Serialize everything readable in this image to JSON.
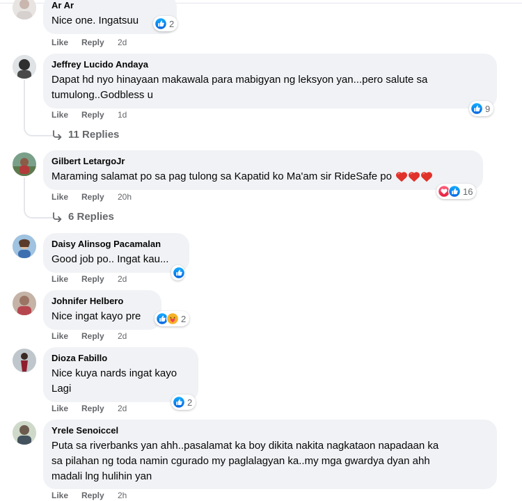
{
  "comments": [
    {
      "author": "Ar Ar",
      "text": "Nice one. Ingatsuu",
      "actions": {
        "like": "Like",
        "reply": "Reply",
        "time": "2d"
      },
      "reactions": {
        "icons": [
          "like"
        ],
        "count": "2"
      }
    },
    {
      "author": "Jeffrey Lucido Andaya",
      "text_lines": [
        "Dapat hd nyo hinayaan makawala para mabigyan ng leksyon yan...pero salute sa",
        "tumulong..Godbless u"
      ],
      "actions": {
        "like": "Like",
        "reply": "Reply",
        "time": "1d"
      },
      "reactions": {
        "icons": [
          "like"
        ],
        "count": "9"
      },
      "replies_label": "11 Replies"
    },
    {
      "author": "Gilbert LetargoJr",
      "text": "Maraming salamat po sa pag tulong sa Kapatid ko Ma'am sir RideSafe po",
      "emoji": [
        "heart",
        "heart",
        "heart"
      ],
      "actions": {
        "like": "Like",
        "reply": "Reply",
        "time": "20h"
      },
      "reactions": {
        "icons": [
          "love",
          "like"
        ],
        "count": "16"
      },
      "replies_label": "6 Replies"
    },
    {
      "author": "Daisy Alinsog Pacamalan",
      "text": "Good job po.. Ingat kau...",
      "actions": {
        "like": "Like",
        "reply": "Reply",
        "time": "2d"
      },
      "reactions": {
        "icons": [
          "like"
        ],
        "count": ""
      }
    },
    {
      "author": "Johnifer Helbero",
      "text": "Nice ingat kayo pre",
      "actions": {
        "like": "Like",
        "reply": "Reply",
        "time": "2d"
      },
      "reactions": {
        "icons": [
          "like",
          "care"
        ],
        "count": "2"
      }
    },
    {
      "author": "Dioza Fabillo",
      "text_lines": [
        "Nice kuya nards ingat kayo",
        "Lagi"
      ],
      "actions": {
        "like": "Like",
        "reply": "Reply",
        "time": "2d"
      },
      "reactions": {
        "icons": [
          "like"
        ],
        "count": "2"
      }
    },
    {
      "author": "Yrele Senoiccel",
      "text_lines": [
        "Puta sa riverbanks yan ahh..pasalamat ka boy dikita nakita nagkataon napadaan ka",
        "sa pilahan ng toda namin cgurado my paglalagyan ka..my mga gwardya dyan ahh",
        "madali lng hulihin yan"
      ],
      "actions": {
        "like": "Like",
        "reply": "Reply",
        "time": "2h"
      }
    }
  ],
  "colors": {
    "bubble": "#f0f2f5",
    "meta_text": "#65676b",
    "like_blue": "#1877f2",
    "love_red": "#f33e58",
    "thread_line": "#e4e6eb"
  }
}
